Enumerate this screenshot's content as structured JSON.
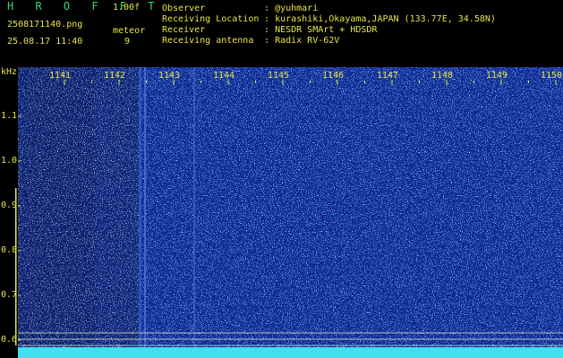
{
  "header": {
    "app_title": "H R O F F T",
    "version": "1.00f",
    "filename": "2508171140.png",
    "timestamp": "25.08.17 11:40",
    "meteor_label": "meteor",
    "meteor_count": "9"
  },
  "info": [
    {
      "key": "Observer",
      "sep": ":",
      "value": "@yuhmari"
    },
    {
      "key": "Receiving Location",
      "sep": ":",
      "value": "kurashiki,Okayama,JAPAN (133.77E, 34.58N)"
    },
    {
      "key": "Receiver",
      "sep": ":",
      "value": "NESDR SMArt + HDSDR"
    },
    {
      "key": "Receiving antenna",
      "sep": ":",
      "value": "Radix RV-62V"
    }
  ],
  "spectrogram": {
    "y_unit": "kHz",
    "x_ticks": [
      "1141",
      "1142",
      "1143",
      "1144",
      "1145",
      "1146",
      "1147",
      "1148",
      "1149",
      "1150"
    ],
    "y_ticks": [
      "1.1",
      "1.0",
      "0.9",
      "0.8",
      "0.7",
      "0.6"
    ],
    "colors": {
      "background": "#0a2a96",
      "label": "#e6e64a",
      "trace": "#40e0f0",
      "grid": "#cfcfcf"
    }
  }
}
